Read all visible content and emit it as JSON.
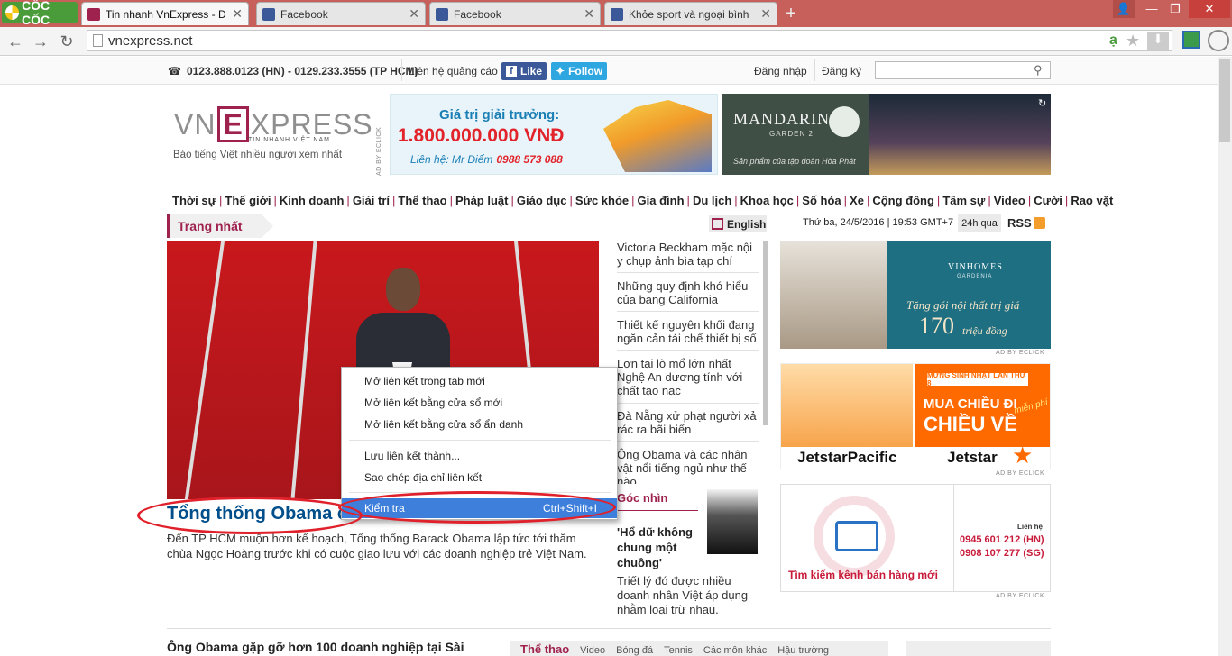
{
  "browser": {
    "brand": "CỐC CỐC",
    "tabs": [
      {
        "title": "Tin nhanh VnExpress - Đọc",
        "active": true
      },
      {
        "title": "Facebook",
        "active": false
      },
      {
        "title": "Facebook",
        "active": false
      },
      {
        "title": "Khỏe sport và ngoại bình",
        "active": false
      }
    ],
    "url": "vnexpress.net"
  },
  "topbar": {
    "phones": "0123.888.0123 (HN) - 0129.233.3555 (TP HCM)",
    "ad_contact": "Liên hệ quảng cáo",
    "like": "Like",
    "follow": "Follow",
    "login": "Đăng nhập",
    "register": "Đăng ký"
  },
  "brand": {
    "logo_left": "VN",
    "logo_e": "E",
    "logo_right": "XPRESS",
    "logo_sub": "TIN NHANH VIỆT NAM",
    "slogan": "Báo tiếng Việt nhiều người xem nhất"
  },
  "ads": {
    "banner1_line1": "Giá trị giải trưởng:",
    "banner1_amount": "1.800.000.000 VNĐ",
    "banner1_contact": "Liên hệ: Mr Điểm",
    "banner1_phone": "0988 573 088",
    "ad_by": "AD BY ECLICK",
    "banner2_brand": "MANDARIN",
    "banner2_sub": "GARDEN 2",
    "banner2_tag": "Sản phẩm của tập đoàn Hòa Phát",
    "vinhomes": "VINHOMES",
    "vinhomes_sub": "GARDENIA",
    "vinhomes_line": "Tặng gói nội thất trị giá",
    "vinhomes_amount": "170",
    "vinhomes_unit": "triệu đồng",
    "jetstar_bday": "MỪNG SINH NHẬT LẦN THỨ 8",
    "jetstar_line1": "MUA CHIỀU ĐI",
    "jetstar_line2": "CHIỀU VỀ",
    "jetstar_free": "miễn phí",
    "jetstar_left": "JetstarPacific",
    "jetstar_right": "Jetstar",
    "shop_contact": "Liên hệ",
    "shop_phone1": "0945 601 212 (HN)",
    "shop_phone2": "0908 107 277 (SG)",
    "shop_caption": "Tìm kiếm kênh bán hàng mới"
  },
  "nav": [
    "Thời sự",
    "Thế giới",
    "Kinh doanh",
    "Giải trí",
    "Thể thao",
    "Pháp luật",
    "Giáo dục",
    "Sức khỏe",
    "Gia đình",
    "Du lịch",
    "Khoa học",
    "Số hóa",
    "Xe",
    "Cộng đồng",
    "Tâm sự",
    "Video",
    "Cười",
    "Rao vặt"
  ],
  "section": {
    "trang_nhat": "Trang nhất",
    "english": "English",
    "date": "Thứ ba, 24/5/2016 | 19:53 GMT+7",
    "h24": "24h qua",
    "rss": "RSS"
  },
  "main_story": {
    "headline": "Tổng thống Obama c",
    "lead": "Đến TP HCM muộn hơn kế hoạch, Tổng thống Barack Obama lập tức tới thăm chùa Ngọc Hoàng trước khi có cuộc giao lưu với các doanh nghiệp trẻ Việt Nam."
  },
  "side_news": [
    "Victoria Beckham mặc nội y chụp ảnh bìa tạp chí",
    "Những quy định khó hiểu của bang California",
    "Thiết kế nguyên khối đang ngăn cản tái chế thiết bị số",
    "Lợn tại lò mổ lớn nhất Nghệ An dương tính với chất tạo nạc",
    "Đà Nẵng xử phạt người xả rác ra bãi biển",
    "Ông Obama và các nhân vật nổi tiếng ngủ như thế nào"
  ],
  "goc_nhin": {
    "label": "Góc nhìn",
    "title": "'Hổ dữ không chung một chuồng'",
    "text": "Triết lý đó được nhiều doanh nhân Việt áp dụng nhằm loại trừ nhau."
  },
  "bottom": {
    "headline": "Ông Obama gặp gỡ hơn 100 doanh nghiệp tại Sài",
    "sport_tabs": [
      "Thể thao",
      "Video",
      "Bóng đá",
      "Tennis",
      "Các môn khác",
      "Hậu trường"
    ]
  },
  "context_menu": {
    "items": [
      "Mở liên kết trong tab mới",
      "Mở liên kết bằng cửa sổ mới",
      "Mở liên kết bằng cửa sổ ẩn danh",
      "Lưu liên kết thành...",
      "Sao chép địa chỉ liên kết"
    ],
    "inspect": "Kiểm tra",
    "inspect_shortcut": "Ctrl+Shift+I"
  },
  "colors": {
    "brand": "#9f224e",
    "titlebar": "#c75f5a",
    "link": "#004f8b",
    "highlight": "#3e7fdb",
    "annotation": "#e0202a"
  }
}
